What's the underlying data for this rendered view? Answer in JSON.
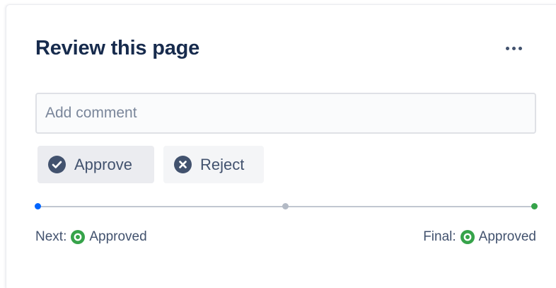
{
  "review": {
    "title": "Review this page",
    "more_label": "More actions",
    "comment_placeholder": "Add comment",
    "actions": {
      "approve_label": "Approve",
      "reject_label": "Reject"
    },
    "progress": {
      "stages": 3,
      "current_stage": 1,
      "colors": {
        "current": "#0065ff",
        "pending": "#b3bac5",
        "final": "#36a34a"
      }
    },
    "next": {
      "label": "Next:",
      "status": "Approved",
      "icon": "approved-status-icon"
    },
    "final": {
      "label": "Final:",
      "status": "Approved",
      "icon": "approved-status-icon"
    }
  }
}
